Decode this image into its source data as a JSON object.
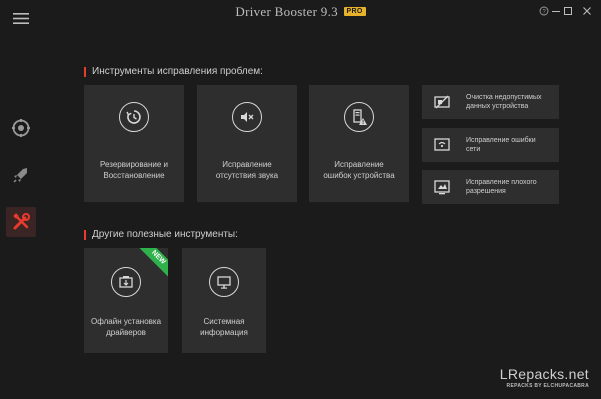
{
  "app": {
    "title": "Driver Booster 9.3",
    "badge": "PRO"
  },
  "sections": {
    "repair_title": "Инструменты исправления проблем:",
    "other_title": "Другие полезные инструменты:"
  },
  "repair_tiles": [
    {
      "label": "Резервирование и\nВосстановление",
      "icon": "restore-icon"
    },
    {
      "label": "Исправление\nотсутствия звука",
      "icon": "mute-speaker-icon"
    },
    {
      "label": "Исправление\nошибок устройства",
      "icon": "device-warning-icon"
    }
  ],
  "repair_small_tiles": [
    {
      "label": "Очистка недопустимых\nданных устройства",
      "icon": "clean-data-icon"
    },
    {
      "label": "Исправление ошибки\nсети",
      "icon": "network-fix-icon"
    },
    {
      "label": "Исправление плохого\nразрешения",
      "icon": "resolution-fix-icon"
    }
  ],
  "other_tiles": [
    {
      "label": "Офлайн установка\nдрайверов",
      "icon": "offline-install-icon",
      "ribbon": "NEW"
    },
    {
      "label": "Системная\nинформация",
      "icon": "monitor-icon"
    }
  ],
  "watermark": {
    "line1": "LRepacks.net",
    "line2": "REPACKS BY ELCHUPACABRA"
  },
  "colors": {
    "accent": "#e83b2d",
    "background": "#1b1b1b",
    "tile": "#2e2e2e",
    "new_ribbon": "#2fb14b",
    "pro_badge": "#e8b12a"
  }
}
